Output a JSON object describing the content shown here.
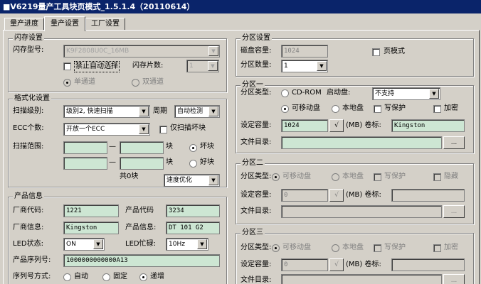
{
  "title": "■V6219量产工具块页模式_1.5.1.4（20110614）",
  "tabs": [
    "量产进度",
    "量产设置",
    "工厂设置"
  ],
  "flash": {
    "group": "闪存设置",
    "model_label": "闪存型号:",
    "model_value": "K9F2808U0C_16MB",
    "disable_auto": "禁止自动选择",
    "chips_label": "闪存片数:",
    "chips_value": "1",
    "single": "单通道",
    "dual": "双通道"
  },
  "format": {
    "group": "格式化设置",
    "scan_level_label": "扫描级别:",
    "scan_level_value": "级别2, 快速扫描",
    "period_label": "周期",
    "period_value": "自动检测",
    "ecc_label": "ECC个数:",
    "ecc_value": "开放一个ECC",
    "scan_bad_only": "仅扫描坏块",
    "range_label": "扫描范围:",
    "dash": "—",
    "block": "块",
    "bad": "坏块",
    "good": "好块",
    "total": "共0块",
    "speed_value": "速度优化"
  },
  "product": {
    "group": "产品信息",
    "vendor_code_label": "厂商代码:",
    "vendor_code": "1221",
    "product_code_label": "产品代码",
    "product_code": "3234",
    "vendor_info_label": "厂商信息:",
    "vendor_info": "Kingston",
    "product_info_label": "产品信息:",
    "product_info": "DT 101 G2",
    "led_label": "LED状态:",
    "led_value": "ON",
    "led_busy_label": "LED忙碌:",
    "led_busy_value": "10Hz",
    "serial_label": "产品序列号:",
    "serial_value": "1000000000000A13",
    "serial_mode_label": "序列号方式:",
    "auto": "自动",
    "fixed": "固定",
    "inc": "递增"
  },
  "partition": {
    "group": "分区设置",
    "capacity_label": "磁盘容量:",
    "capacity_value": "1024",
    "page_mode": "页模式",
    "count_label": "分区数量:",
    "count_value": "1"
  },
  "part1": {
    "group": "分区一",
    "type_label": "分区类型:",
    "cdrom": "CD-ROM",
    "boot_label": "启动盘:",
    "boot_value": "不支持",
    "removable": "可移动盘",
    "local": "本地盘",
    "write_protect": "写保护",
    "encrypt": "加密",
    "cap_label": "设定容量:",
    "cap_value": "1024",
    "unit_label": "(MB) 卷标:",
    "volume": "Kingston",
    "dir_label": "文件目录:",
    "browse": "...",
    "check_mark": "√"
  },
  "part2": {
    "group": "分区二",
    "type_label": "分区类型:",
    "removable": "可移动盘",
    "local": "本地盘",
    "write_protect": "写保护",
    "hidden": "隐藏",
    "cap_label": "设定容量:",
    "cap_value": "0",
    "unit_label": "(MB) 卷标:",
    "dir_label": "文件目录:",
    "browse": "...",
    "check_mark": "√"
  },
  "part3": {
    "group": "分区三",
    "type_label": "分区类型:",
    "removable": "可移动盘",
    "local": "本地盘",
    "write_protect": "写保护",
    "encrypt": "加密",
    "cap_label": "设定容量:",
    "cap_value": "0",
    "unit_label": "(MB) 卷标:",
    "dir_label": "文件目录:",
    "browse": "...",
    "check_mark": "√"
  }
}
